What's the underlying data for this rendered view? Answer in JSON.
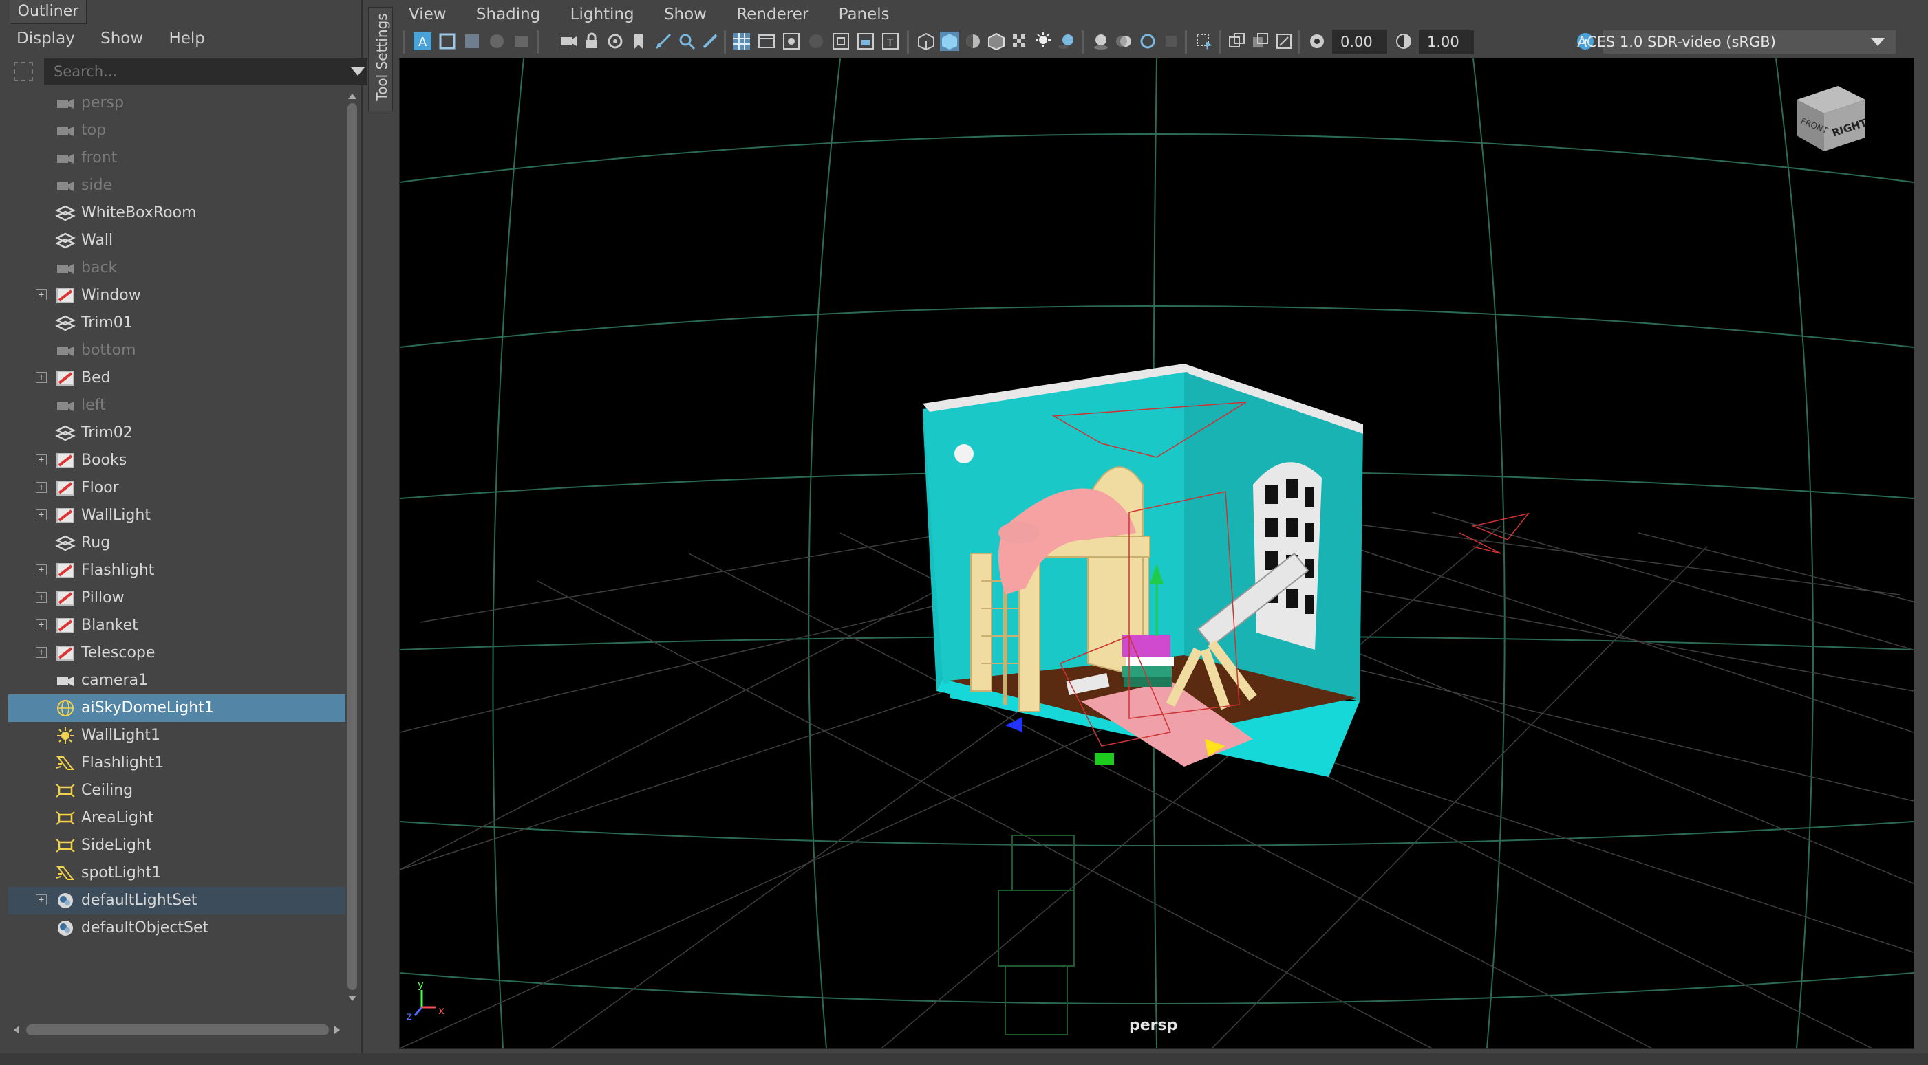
{
  "outliner": {
    "title": "Outliner",
    "menu": [
      "Display",
      "Show",
      "Help"
    ],
    "search_placeholder": "Search...",
    "items": [
      {
        "label": "persp",
        "icon": "camera-icon",
        "dim": true
      },
      {
        "label": "top",
        "icon": "camera-icon",
        "dim": true
      },
      {
        "label": "front",
        "icon": "camera-icon",
        "dim": true
      },
      {
        "label": "side",
        "icon": "camera-icon",
        "dim": true
      },
      {
        "label": "WhiteBoxRoom",
        "icon": "mesh-icon"
      },
      {
        "label": "Wall",
        "icon": "mesh-icon"
      },
      {
        "label": "back",
        "icon": "camera-icon",
        "dim": true
      },
      {
        "label": "Window",
        "icon": "group-icon",
        "expand": true
      },
      {
        "label": "Trim01",
        "icon": "mesh-icon"
      },
      {
        "label": "bottom",
        "icon": "camera-icon",
        "dim": true
      },
      {
        "label": "Bed",
        "icon": "group-icon",
        "expand": true
      },
      {
        "label": "left",
        "icon": "camera-icon",
        "dim": true
      },
      {
        "label": "Trim02",
        "icon": "mesh-icon"
      },
      {
        "label": "Books",
        "icon": "group-icon",
        "expand": true
      },
      {
        "label": "Floor",
        "icon": "group-icon",
        "expand": true
      },
      {
        "label": "WallLight",
        "icon": "group-icon",
        "expand": true
      },
      {
        "label": "Rug",
        "icon": "mesh-icon"
      },
      {
        "label": "Flashlight",
        "icon": "group-icon",
        "expand": true
      },
      {
        "label": "Pillow",
        "icon": "group-icon",
        "expand": true
      },
      {
        "label": "Blanket",
        "icon": "group-icon",
        "expand": true
      },
      {
        "label": "Telescope",
        "icon": "group-icon",
        "expand": true
      },
      {
        "label": "camera1",
        "icon": "camera-icon"
      },
      {
        "label": "aiSkyDomeLight1",
        "icon": "skydome-light-icon",
        "selected": true
      },
      {
        "label": "WallLight1",
        "icon": "point-light-icon"
      },
      {
        "label": "Flashlight1",
        "icon": "spot-light-icon"
      },
      {
        "label": "Ceiling",
        "icon": "area-light-icon"
      },
      {
        "label": "AreaLight",
        "icon": "area-light-icon"
      },
      {
        "label": "SideLight",
        "icon": "area-light-icon"
      },
      {
        "label": "spotLight1",
        "icon": "spot-light-icon"
      },
      {
        "label": "defaultLightSet",
        "icon": "set-icon",
        "expand": true,
        "highlight": true
      },
      {
        "label": "defaultObjectSet",
        "icon": "set-icon"
      }
    ]
  },
  "tool_settings": {
    "label": "Tool Settings"
  },
  "panel_menu": [
    "View",
    "Shading",
    "Lighting",
    "Show",
    "Renderer",
    "Panels"
  ],
  "toolbar": {
    "exposure_value": "0.00",
    "gamma_value": "1.00",
    "color_management": "ACES 1.0 SDR-video (sRGB)"
  },
  "viewport": {
    "camera_name": "persp",
    "viewcube_faces": [
      "FRONT",
      "RIGHT"
    ],
    "axis_labels": [
      "x",
      "y",
      "z"
    ]
  }
}
